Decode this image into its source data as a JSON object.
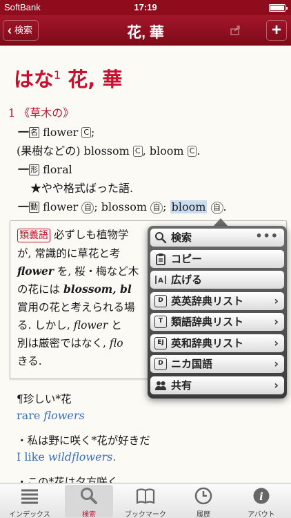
{
  "status_bar": {
    "carrier": "SoftBank",
    "time": "17:19"
  },
  "nav": {
    "back_label": "検索",
    "title": "花, 華"
  },
  "entry": {
    "reading": "はな",
    "number": "1",
    "kanji": "花, 華",
    "sense": "1 《草木の》",
    "lines": {
      "noun_pos": "名",
      "noun_word": "flower",
      "noun_mark": "C",
      "fruit_prefix": "(果樹などの) blossom",
      "fruit_mark1": "C",
      "fruit_mid": ", bloom",
      "fruit_mark2": "C",
      "adj_pos": "形",
      "adj_word": "floral",
      "adj_note": "★やや格式ばった語.",
      "verb_pos": "動",
      "verb_w1": "flower",
      "verb_m1": "自",
      "verb_w2": "; blossom",
      "verb_m2": "自",
      "verb_sep": ";",
      "verb_w3": "bloom",
      "verb_m3": "自",
      "verb_end": "."
    },
    "synonym_note": {
      "tag": "類義語",
      "l1": "必ずしも植物学",
      "l2a": "が, 常識的に草花と考",
      "l3a": "flower",
      "l3b": "を, 桜・梅など木",
      "l4a": "の花には",
      "l4b": "blossom, bl",
      "l5": "賞用の花と考えられる場",
      "l6a": "る. しかし,",
      "l6b": "flower",
      "l6c": "と",
      "l7a": "別は厳密ではなく,",
      "l7b": "flo",
      "l8": "きる."
    },
    "examples": [
      {
        "ja": "¶珍しい*花",
        "en_plain": "rare ",
        "en_italic": "flowers"
      },
      {
        "ja": "・私は野に咲く*花が好きだ",
        "en_plain": "I like ",
        "en_italic": "wildflowers."
      },
      {
        "ja": "・この*花は夕方咲く"
      }
    ]
  },
  "popover": {
    "items": [
      {
        "label": "検索",
        "icon": "search-icon",
        "trailing": "•••"
      },
      {
        "label": "コピー",
        "icon": "clipboard-icon"
      },
      {
        "label": "広げる",
        "icon": "expand-icon"
      },
      {
        "label": "英英辞典リスト",
        "icon": "dictionary-icon",
        "trailing": "›"
      },
      {
        "label": "類語辞典リスト",
        "icon": "thesaurus-icon",
        "trailing": "›"
      },
      {
        "label": "英和辞典リスト",
        "icon": "ej-dictionary-icon",
        "trailing": "›"
      },
      {
        "label": "ニカ国語",
        "icon": "bilingual-icon",
        "trailing": "›"
      },
      {
        "label": "共有",
        "icon": "people-icon",
        "trailing": "›"
      }
    ]
  },
  "tabbar": {
    "tabs": [
      {
        "label": "インデックス",
        "icon": "list-icon"
      },
      {
        "label": "検索",
        "icon": "search-icon",
        "active": true
      },
      {
        "label": "ブックマーク",
        "icon": "book-icon"
      },
      {
        "label": "履歴",
        "icon": "clock-icon"
      },
      {
        "label": "アバウト",
        "icon": "info-icon"
      }
    ]
  },
  "colors": {
    "brand": "#8e0c1c",
    "accent": "#c8102e",
    "example_blue": "#3a6fb8",
    "selection": "#c9dcf2"
  }
}
